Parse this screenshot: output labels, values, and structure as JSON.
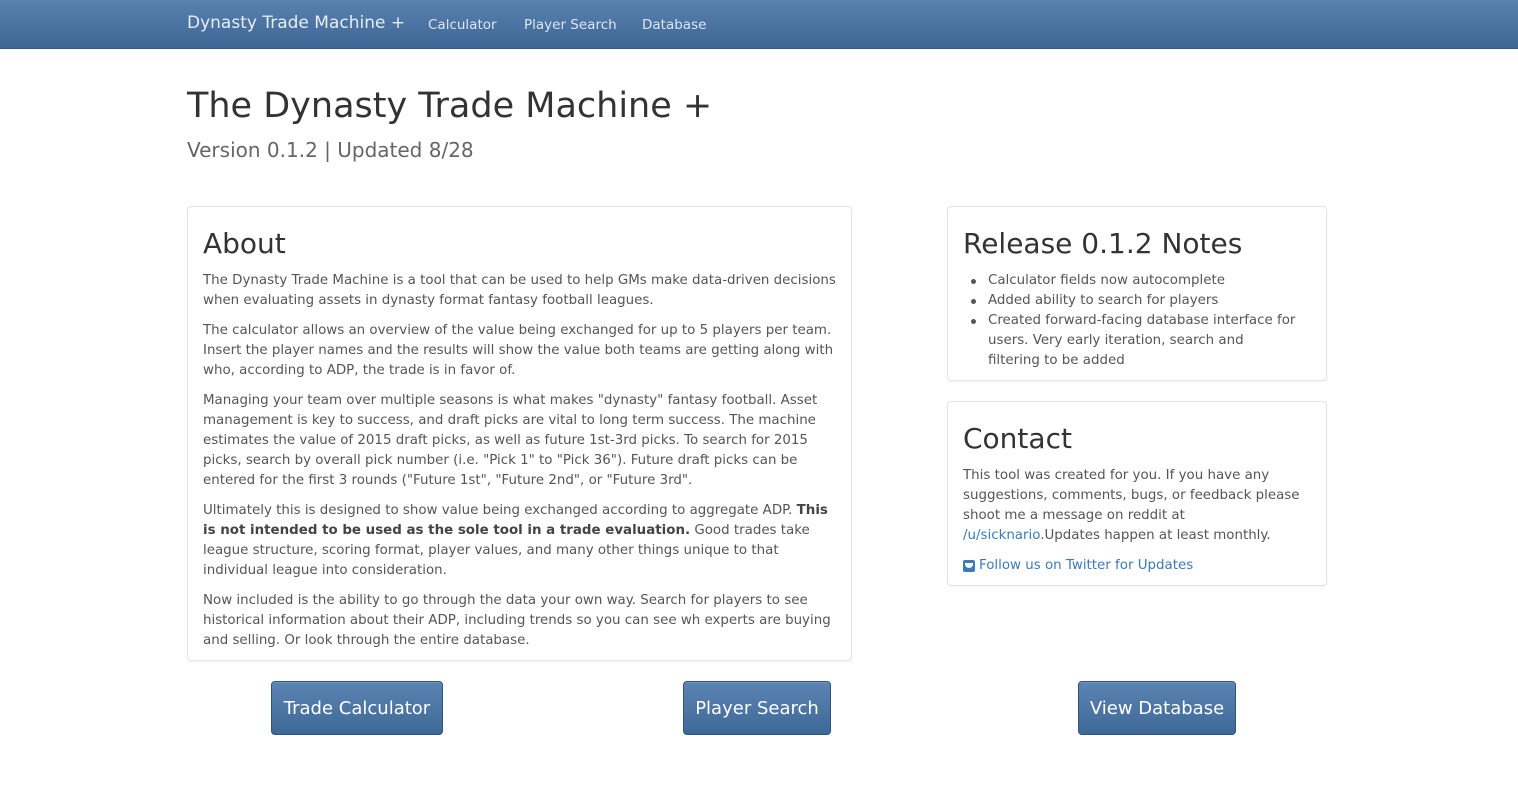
{
  "navbar": {
    "brand": "Dynasty Trade Machine +",
    "links": [
      "Calculator",
      "Player Search",
      "Database"
    ]
  },
  "header": {
    "title": "The Dynasty Trade Machine +",
    "subtitle": "Version 0.1.2 | Updated 8/28"
  },
  "about": {
    "heading": "About",
    "p1": "The Dynasty Trade Machine is a tool that can be used to help GMs make data-driven decisions when evaluating assets in dynasty format fantasy football leagues.",
    "p2": "The calculator allows an overview of the value being exchanged for up to 5 players per team. Insert the player names and the results will show the value both teams are getting along with who, according to ADP, the trade is in favor of.",
    "p3": "Managing your team over multiple seasons is what makes \"dynasty\" fantasy football. Asset management is key to success, and draft picks are vital to long term success. The machine estimates the value of 2015 draft picks, as well as future 1st-3rd picks. To search for 2015 picks, search by overall pick number (i.e. \"Pick 1\" to \"Pick 36\"). Future draft picks can be entered for the first 3 rounds (\"Future 1st\", \"Future 2nd\", or \"Future 3rd\".",
    "p4_start": "Ultimately this is designed to show value being exchanged according to aggregate ADP. ",
    "p4_bold": "This is not intended to be used as the sole tool in a trade evaluation.",
    "p4_end": " Good trades take league structure, scoring format, player values, and many other things unique to that individual league into consideration.",
    "p5": "Now included is the ability to go through the data your own way. Search for players to see historical information about their ADP, including trends so you can see wh experts are buying and selling. Or look through the entire database."
  },
  "notes": {
    "heading": "Release 0.1.2 Notes",
    "items": [
      "Calculator fields now autocomplete",
      "Added ability to search for players",
      "Created forward-facing database interface for users. Very early iteration, search and filtering to be added"
    ]
  },
  "contact": {
    "heading": "Contact",
    "text": "This tool was created for you. If you have any suggestions, comments, bugs, or feedback please shoot me a message on reddit at ",
    "reddit_link": "/u/sicknario",
    "text_end": ".Updates happen at least monthly.",
    "twitter_link": "Follow us on Twitter for Updates",
    "twitter_icon": "twitter-icon"
  },
  "buttons": {
    "calculator": "Trade Calculator",
    "search": "Player Search",
    "database": "View Database"
  },
  "colors": {
    "navbar": "#4c74a3",
    "button": "#4a739f",
    "link": "#3d7ab8"
  }
}
